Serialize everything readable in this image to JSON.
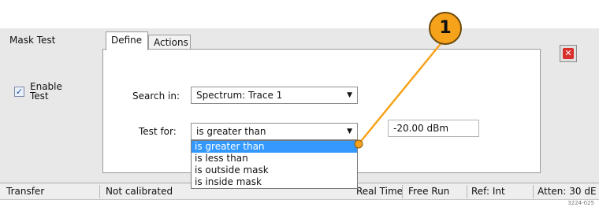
{
  "dialog": {
    "title": "Mask Test",
    "tabs": [
      {
        "label": "Define"
      },
      {
        "label": "Actions"
      }
    ],
    "enable_test": {
      "label": "Enable\nTest",
      "checked": true
    }
  },
  "define": {
    "search_in": {
      "label": "Search in:",
      "value": "Spectrum: Trace 1"
    },
    "test_for": {
      "label": "Test for:",
      "value": "is greater than",
      "options": [
        "is greater than",
        "is less than",
        "is outside mask",
        "is inside mask"
      ],
      "selected_index": 0
    },
    "threshold": {
      "value": "-20.00 dBm"
    }
  },
  "status_bar": {
    "items": [
      "Transfer",
      "Not calibrated",
      "Real Time",
      "Free Run",
      "Ref: Int",
      "Atten: 30 dE"
    ]
  },
  "callout": {
    "number": "1",
    "color": "#f7a21b"
  },
  "figure_tag": "3224-025",
  "icons": {
    "checkbox": "check-icon",
    "close": "close-icon",
    "dropdown": "chevron-down-icon"
  },
  "colors": {
    "highlight": "#3399ff",
    "close_red": "#d9302c",
    "callout": "#f7a21b"
  }
}
